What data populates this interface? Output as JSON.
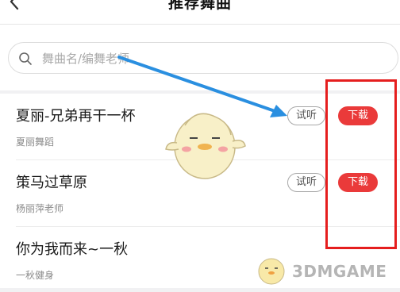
{
  "header": {
    "title": "推荐舞曲"
  },
  "search": {
    "placeholder": "舞曲名/编舞老师"
  },
  "songs": [
    {
      "name": "夏丽-兄弟再干一杯",
      "teacher": "夏丽舞蹈",
      "listen_label": "试听",
      "download_label": "下载"
    },
    {
      "name": "策马过草原",
      "teacher": "杨丽萍老师",
      "listen_label": "试听",
      "download_label": "下载"
    },
    {
      "name": "你为我而来~一秋",
      "teacher": "一秋健身"
    }
  ],
  "annotation": {
    "highlight_color": "#e51e1e",
    "arrow_color": "#2a8fe0"
  },
  "watermark": {
    "text": "3DMGAME"
  },
  "colors": {
    "download_button": "#ea3a3a"
  },
  "icons": {
    "back": "chevron-left-icon",
    "search": "search-icon"
  }
}
